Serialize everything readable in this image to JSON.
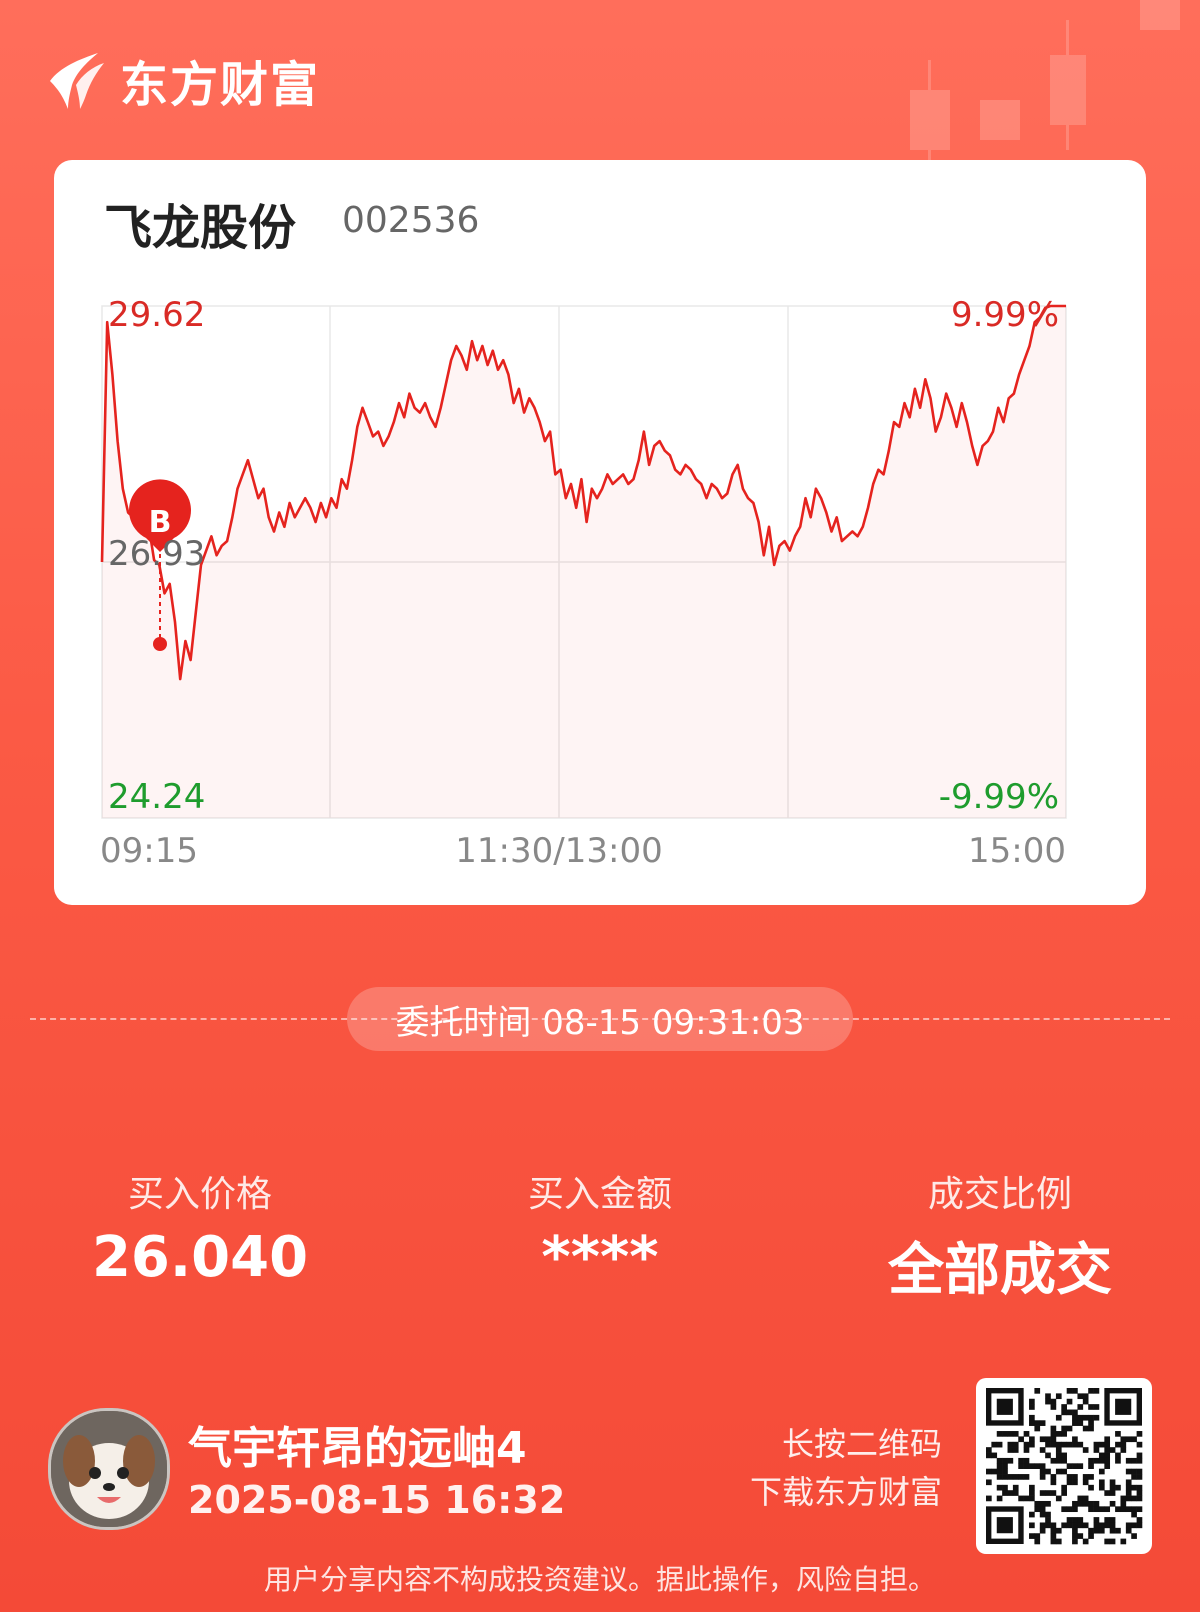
{
  "brand": {
    "name": "东方财富"
  },
  "stock": {
    "name": "飞龙股份",
    "code": "002536"
  },
  "chart_data": {
    "type": "line",
    "price_high_label": "29.62",
    "price_mid_label": "26.93",
    "price_low_label": "24.24",
    "pct_high_label": "9.99%",
    "pct_low_label": "-9.99%",
    "time_labels": [
      "09:15",
      "11:30/13:00",
      "15:00"
    ],
    "ylim": [
      24.24,
      29.62
    ],
    "prev_close": 26.93,
    "buy_marker": "B",
    "colors": {
      "line": "#e5231e",
      "up": "#d92a25",
      "down": "#1e9c2d",
      "neutral": "#666666"
    },
    "series": [
      {
        "values": [
          26.93,
          29.45,
          28.9,
          28.2,
          27.7,
          27.45,
          27.4,
          27.45,
          27.4,
          27.3,
          26.95,
          26.9,
          26.6,
          26.7,
          26.3,
          25.7,
          26.1,
          25.9,
          26.4,
          26.9,
          27.05,
          27.2,
          27.0,
          27.1,
          27.15,
          27.4,
          27.7,
          27.85,
          28.0,
          27.8,
          27.6,
          27.7,
          27.4,
          27.25,
          27.45,
          27.3,
          27.55,
          27.4,
          27.5,
          27.6,
          27.5,
          27.35,
          27.55,
          27.4,
          27.6,
          27.5,
          27.8,
          27.7,
          28.0,
          28.35,
          28.55,
          28.4,
          28.25,
          28.3,
          28.15,
          28.25,
          28.4,
          28.6,
          28.45,
          28.7,
          28.55,
          28.5,
          28.6,
          28.45,
          28.35,
          28.55,
          28.8,
          29.05,
          29.2,
          29.1,
          28.95,
          29.25,
          29.05,
          29.2,
          29.0,
          29.15,
          28.95,
          29.05,
          28.9,
          28.6,
          28.75,
          28.5,
          28.65,
          28.55,
          28.4,
          28.2,
          28.3,
          27.85,
          27.9,
          27.6,
          27.75,
          27.5,
          27.8,
          27.35,
          27.7,
          27.6,
          27.7,
          27.85,
          27.75,
          27.8,
          27.85,
          27.75,
          27.8,
          28.0,
          28.3,
          27.95,
          28.15,
          28.2,
          28.1,
          28.05,
          27.9,
          27.85,
          27.95,
          27.9,
          27.8,
          27.75,
          27.6,
          27.75,
          27.7,
          27.6,
          27.65,
          27.85,
          27.95,
          27.7,
          27.6,
          27.55,
          27.35,
          27.0,
          27.3,
          26.9,
          27.1,
          27.15,
          27.05,
          27.2,
          27.3,
          27.6,
          27.4,
          27.7,
          27.6,
          27.45,
          27.25,
          27.4,
          27.15,
          27.2,
          27.25,
          27.2,
          27.3,
          27.5,
          27.75,
          27.9,
          27.85,
          28.1,
          28.4,
          28.35,
          28.6,
          28.45,
          28.75,
          28.55,
          28.85,
          28.65,
          28.3,
          28.45,
          28.7,
          28.55,
          28.35,
          28.6,
          28.4,
          28.15,
          27.95,
          28.15,
          28.2,
          28.3,
          28.55,
          28.4,
          28.65,
          28.7,
          28.9,
          29.05,
          29.2,
          29.45,
          29.5,
          29.6,
          29.62,
          29.62,
          29.62,
          29.62
        ]
      }
    ]
  },
  "entrust": {
    "label": "委托时间 08-15 09:31:03"
  },
  "stats": [
    {
      "label": "买入价格",
      "value": "26.040"
    },
    {
      "label": "买入金额",
      "value": "****"
    },
    {
      "label": "成交比例",
      "value": "全部成交"
    }
  ],
  "user": {
    "name": "气宇轩昂的远岫4",
    "time": "2025-08-15 16:32"
  },
  "qr": {
    "line1": "长按二维码",
    "line2": "下载东方财富"
  },
  "footer": {
    "disclaimer": "用户分享内容不构成投资建议。据此操作，风险自担。"
  }
}
